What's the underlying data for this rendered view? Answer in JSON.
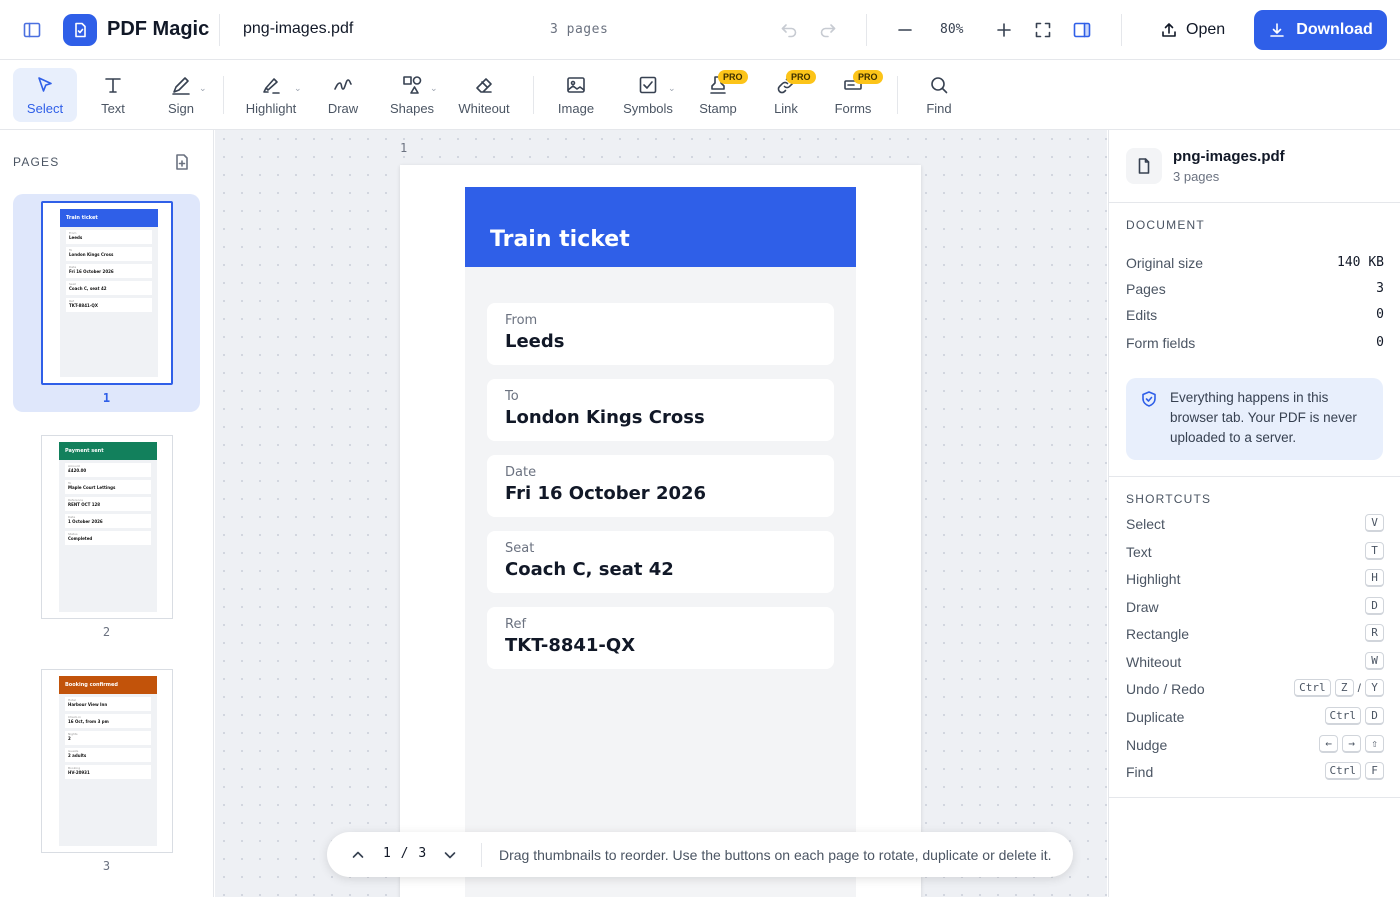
{
  "app": {
    "name": "PDF Magic"
  },
  "header": {
    "file_name": "png-images.pdf",
    "page_count": "3 pages",
    "zoom": "80%",
    "open_label": "Open",
    "download_label": "Download"
  },
  "toolbar": {
    "tools": [
      {
        "label": "Select",
        "icon": "cursor-icon"
      },
      {
        "label": "Text",
        "icon": "text-icon"
      },
      {
        "label": "Sign",
        "icon": "pen-icon"
      },
      {
        "label": "Highlight",
        "icon": "highlighter-icon"
      },
      {
        "label": "Draw",
        "icon": "squiggle-icon"
      },
      {
        "label": "Shapes",
        "icon": "shapes-icon"
      },
      {
        "label": "Whiteout",
        "icon": "eraser-icon"
      },
      {
        "label": "Image",
        "icon": "image-icon"
      },
      {
        "label": "Symbols",
        "icon": "checkbox-icon"
      },
      {
        "label": "Stamp",
        "icon": "stamp-icon"
      },
      {
        "label": "Link",
        "icon": "link-icon"
      },
      {
        "label": "Forms",
        "icon": "form-icon"
      },
      {
        "label": "Find",
        "icon": "search-icon"
      }
    ],
    "pro_badge": "PRO"
  },
  "sidebar": {
    "title": "PAGES",
    "thumbnails": [
      {
        "num": "1",
        "title": "Train ticket",
        "color": "#2f5fe8",
        "rows": [
          [
            "From",
            "Leeds"
          ],
          [
            "To",
            "London Kings Cross"
          ],
          [
            "Date",
            "Fri 16 October 2026"
          ],
          [
            "Seat",
            "Coach C, seat 42"
          ],
          [
            "Ref",
            "TKT-8841-QX"
          ]
        ]
      },
      {
        "num": "2",
        "title": "Payment sent",
        "color": "#12805c",
        "rows": [
          [
            "Amount",
            "£420.00"
          ],
          [
            "To",
            "Maple Court Lettings"
          ],
          [
            "Reference",
            "RENT OCT 128"
          ],
          [
            "Date",
            "1 October 2026"
          ],
          [
            "Status",
            "Completed"
          ]
        ]
      },
      {
        "num": "3",
        "title": "Booking confirmed",
        "color": "#c2530a",
        "rows": [
          [
            "Hotel",
            "Harbour View Inn"
          ],
          [
            "Check-in",
            "16 Oct, from 3 pm"
          ],
          [
            "Nights",
            "2"
          ],
          [
            "Guests",
            "2 adults"
          ],
          [
            "Booking",
            "HV-20931"
          ]
        ]
      }
    ]
  },
  "canvas": {
    "page_label": "1",
    "ticket": {
      "title": "Train ticket",
      "fields": [
        {
          "label": "From",
          "value": "Leeds"
        },
        {
          "label": "To",
          "value": "London Kings Cross"
        },
        {
          "label": "Date",
          "value": "Fri 16 October 2026"
        },
        {
          "label": "Seat",
          "value": "Coach C, seat 42"
        },
        {
          "label": "Ref",
          "value": "TKT-8841-QX"
        }
      ]
    }
  },
  "pager": {
    "current": "1",
    "separator": "/",
    "total": "3",
    "hint": "Drag thumbnails to reorder. Use the buttons on each page to rotate, duplicate or delete it."
  },
  "panel": {
    "file_name": "png-images.pdf",
    "file_pages": "3 pages",
    "document_title": "DOCUMENT",
    "stats": [
      {
        "key": "Original size",
        "value": "140 KB"
      },
      {
        "key": "Pages",
        "value": "3"
      },
      {
        "key": "Edits",
        "value": "0"
      },
      {
        "key": "Form fields",
        "value": "0"
      }
    ],
    "privacy": "Everything happens in this browser tab. Your PDF is never uploaded to a server.",
    "shortcuts_title": "SHORTCUTS",
    "shortcuts": [
      {
        "name": "Select",
        "keys": [
          "V"
        ]
      },
      {
        "name": "Text",
        "keys": [
          "T"
        ]
      },
      {
        "name": "Highlight",
        "keys": [
          "H"
        ]
      },
      {
        "name": "Draw",
        "keys": [
          "D"
        ]
      },
      {
        "name": "Rectangle",
        "keys": [
          "R"
        ]
      },
      {
        "name": "Whiteout",
        "keys": [
          "W"
        ]
      },
      {
        "name": "Undo / Redo",
        "keys": [
          "Ctrl",
          "Z",
          "/",
          "Y"
        ]
      },
      {
        "name": "Duplicate",
        "keys": [
          "Ctrl",
          "D"
        ]
      },
      {
        "name": "Nudge",
        "keys": [
          "←",
          "→",
          "⇧"
        ]
      },
      {
        "name": "Find",
        "keys": [
          "Ctrl",
          "F"
        ]
      }
    ]
  },
  "colors": {
    "accent": "#2f5fe8",
    "pro": "#fcc419"
  }
}
